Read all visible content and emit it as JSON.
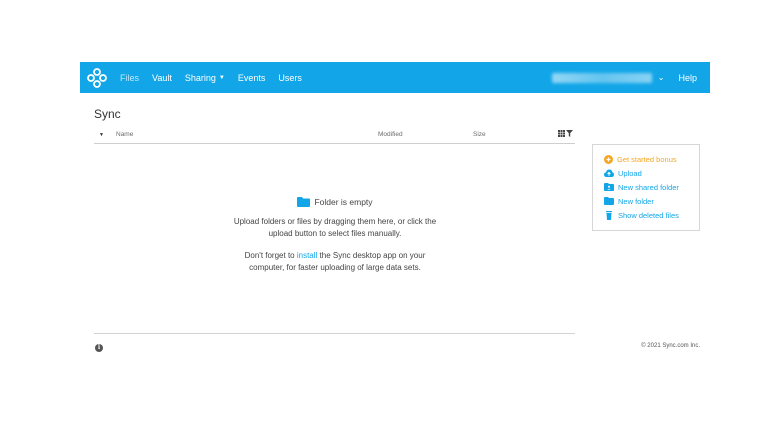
{
  "nav": {
    "items": [
      {
        "label": "Files"
      },
      {
        "label": "Vault"
      },
      {
        "label": "Sharing"
      },
      {
        "label": "Events"
      },
      {
        "label": "Users"
      }
    ],
    "help": "Help"
  },
  "page": {
    "title": "Sync"
  },
  "table": {
    "columns": {
      "name": "Name",
      "modified": "Modified",
      "size": "Size"
    }
  },
  "empty": {
    "heading": "Folder is empty",
    "line1": "Upload folders or files by dragging them here, or click the upload button to select files manually.",
    "line2_pre": "Don't forget to ",
    "line2_link": "install",
    "line2_post": " the Sync desktop app on your computer, for faster uploading of large data sets."
  },
  "actions": {
    "bonus": "Get started bonus",
    "upload": "Upload",
    "shared": "New shared folder",
    "folder": "New folder",
    "deleted": "Show deleted files"
  },
  "footer": {
    "copyright": "© 2021 Sync.com Inc."
  },
  "colors": {
    "brand": "#12a6e8",
    "bonus": "#f5a623"
  }
}
